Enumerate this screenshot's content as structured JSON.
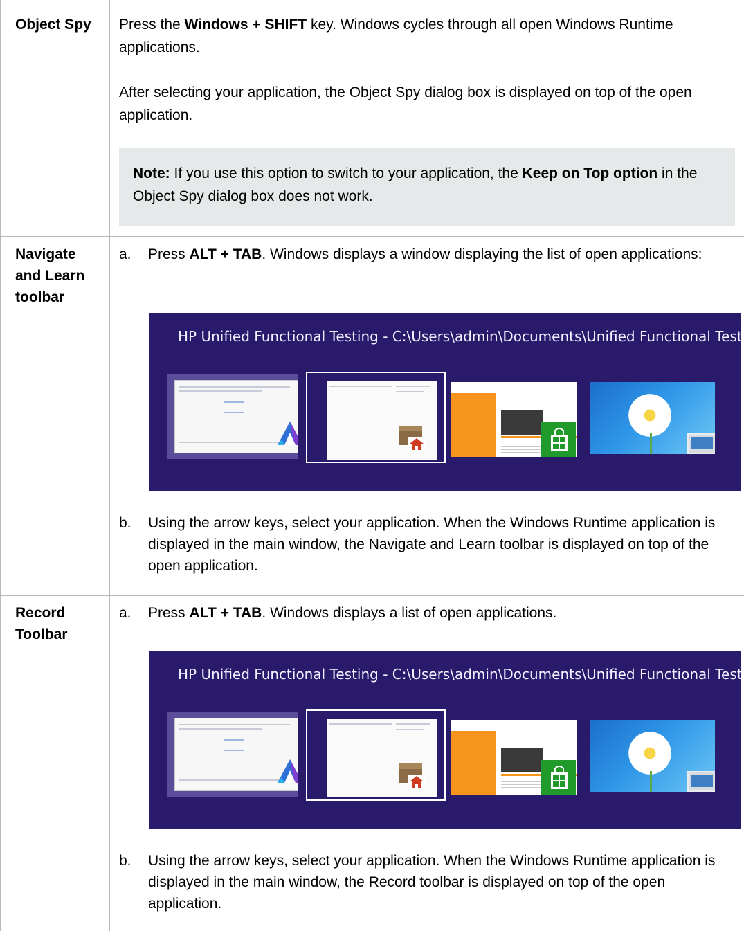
{
  "rows": [
    {
      "label": "Object Spy",
      "para1_pre": "Press the ",
      "para1_bold": "Windows + SHIFT",
      "para1_post": " key. Windows cycles through all open Windows Runtime applications.",
      "para2": "After selecting your application, the Object Spy dialog box is displayed on top of the open application.",
      "note_label": "Note:",
      "note_pre": " If you use this option to switch to your application, the ",
      "note_bold": "Keep on Top option",
      "note_post": " in the Object Spy dialog box does not work."
    },
    {
      "label": "Navigate and Learn toolbar",
      "step_a_marker": "a.",
      "step_a_pre": "Press ",
      "step_a_bold": "ALT + TAB",
      "step_a_post": ". Windows displays a window displaying the list of open applications:",
      "screenshot_caption": "HP Unified Functional Testing - C:\\Users\\admin\\Documents\\Unified Functional Test...",
      "step_b_marker": "b.",
      "step_b_text": "Using the arrow keys, select your application. When the Windows Runtime application is displayed in the main window, the Navigate and Learn toolbar is displayed on top of the open application."
    },
    {
      "label": "Record Toolbar",
      "step_a_marker": "a.",
      "step_a_pre": "Press ",
      "step_a_bold": "ALT + TAB",
      "step_a_post": ". Windows displays a list of open applications.",
      "screenshot_caption": "HP Unified Functional Testing - C:\\Users\\admin\\Documents\\Unified Functional Test...",
      "step_b_marker": "b.",
      "step_b_text": "Using the arrow keys, select your application. When the Windows Runtime application is displayed in the main window, the Record toolbar is displayed on top of the open application."
    }
  ],
  "colors": {
    "border": "#b8b8b8",
    "note_bg": "#e6e9e9",
    "alt_tab_bg": "#2a1a6c"
  },
  "icons": [
    "uft-logo-icon",
    "package-home-icon",
    "windows-store-icon",
    "desktop-laptop-icon"
  ]
}
